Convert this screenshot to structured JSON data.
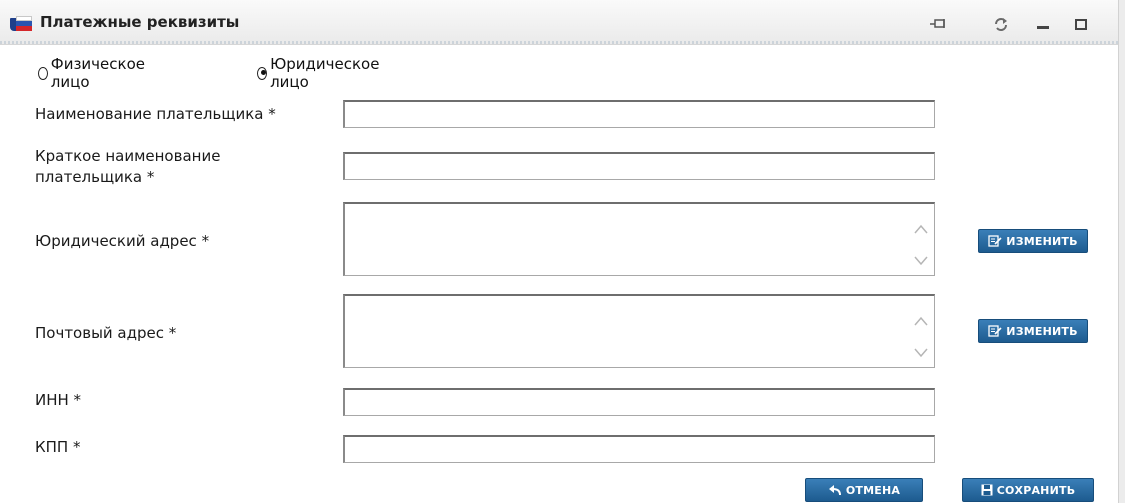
{
  "window": {
    "title": "Платежные реквизиты"
  },
  "titlebar": {
    "buttons": [
      "pin-icon",
      "refresh-icon",
      "minimize-icon",
      "maximize-icon"
    ]
  },
  "person_type": {
    "options": [
      {
        "label": "Физическое лицо",
        "checked": false
      },
      {
        "label": "Юридическое лицо",
        "checked": true
      }
    ]
  },
  "form": {
    "payer_name": {
      "label": "Наименование плательщика *",
      "value": ""
    },
    "payer_short_name": {
      "label_line1": "Краткое наименование",
      "label_line2": "плательщика *",
      "value": ""
    },
    "legal_address": {
      "label": "Юридический адрес *",
      "value": "",
      "edit_button": "ИЗМЕНИТЬ"
    },
    "postal_address": {
      "label": "Почтовый адрес *",
      "value": "",
      "edit_button": "ИЗМЕНИТЬ"
    },
    "inn": {
      "label": "ИНН *",
      "value": ""
    },
    "kpp": {
      "label": "КПП *",
      "value": ""
    }
  },
  "footer": {
    "cancel_label": "ОТМЕНА",
    "save_label": "СОХРАНИТЬ"
  },
  "colors": {
    "button_blue": "#1d5b8f",
    "button_text": "#ffffff"
  }
}
